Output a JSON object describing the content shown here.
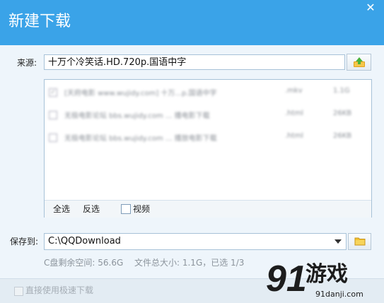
{
  "window": {
    "title": "新建下载",
    "close_glyph": "✕"
  },
  "source": {
    "label": "来源:",
    "value": "十万个冷笑话.HD.720p.国语中字"
  },
  "file_list": {
    "rows": [
      {
        "name": "[天府电影 www.wujidy.com] 十万...p.国语中字",
        "ext": ".mkv",
        "size": "1.1G",
        "checked": true
      },
      {
        "name": "无极电影论坛 bbs.wujidy.com ... 播电影下载",
        "ext": ".html",
        "size": "26KB",
        "checked": false
      },
      {
        "name": "无极电影论坛 bbs.wujidy.com ... 播放电影下载",
        "ext": ".html",
        "size": "26KB",
        "checked": false
      }
    ],
    "select_all": "全选",
    "invert": "反选",
    "video_label": "视频"
  },
  "save": {
    "label": "保存到:",
    "path": "C:\\QQDownload"
  },
  "info": {
    "free_space": "C盘剩余空间: 56.6G",
    "total": "文件总大小: 1.1G，已选 1/3"
  },
  "fast_download": {
    "label": "直接使用极速下载",
    "checked": false
  },
  "watermark": {
    "logo_text": "91",
    "text": "游戏",
    "url": "91danji.com"
  },
  "colors": {
    "titlebar": "#3aa3e8",
    "folder_icon": "#f2c230",
    "upload_icon": "#e0a21a"
  }
}
